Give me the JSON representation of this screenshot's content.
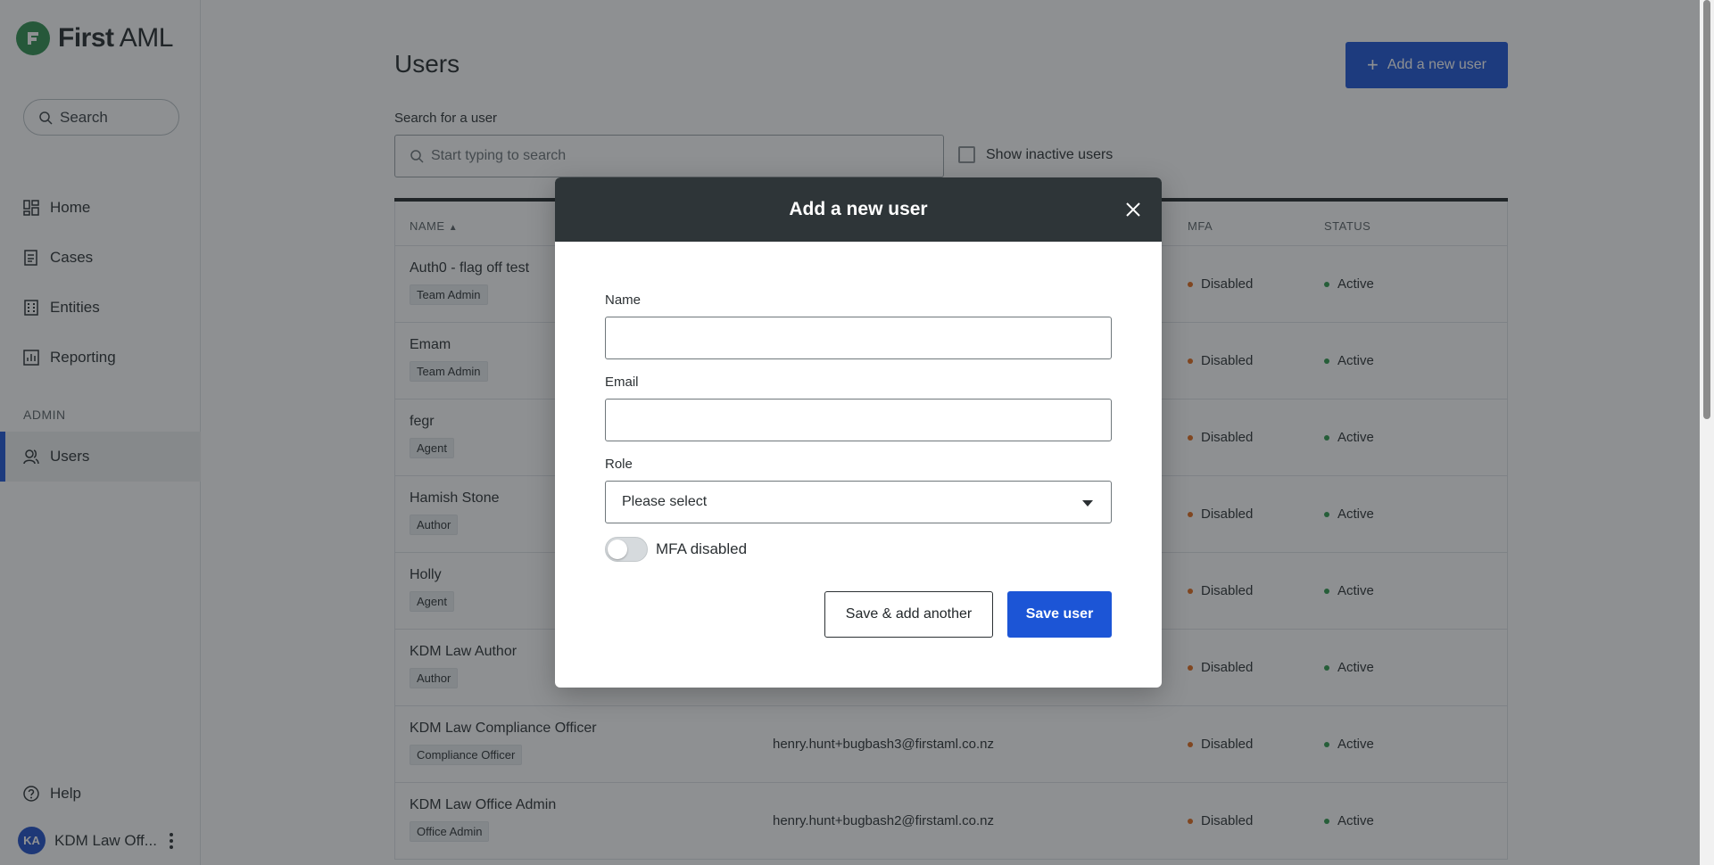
{
  "brand": {
    "name_bold": "First",
    "name_light": " AML",
    "accent": "#1c55d6",
    "logo_color": "#2f8f4e"
  },
  "sidebar": {
    "search_label": "Search",
    "items": [
      {
        "label": "Home",
        "icon": "grid-icon"
      },
      {
        "label": "Cases",
        "icon": "document-icon"
      },
      {
        "label": "Entities",
        "icon": "building-icon"
      },
      {
        "label": "Reporting",
        "icon": "chart-icon"
      }
    ],
    "admin_section": "ADMIN",
    "admin_items": [
      {
        "label": "Users",
        "icon": "users-icon",
        "active": true
      }
    ],
    "help_label": "Help",
    "user_initials": "KA",
    "user_name": "KDM Law Off..."
  },
  "main": {
    "title": "Users",
    "add_button": "Add a new user",
    "search_label": "Search for a user",
    "search_placeholder": "Start typing to search",
    "show_inactive_label": "Show inactive users",
    "columns": {
      "name": "NAME",
      "mfa": "MFA",
      "status": "STATUS"
    },
    "rows": [
      {
        "name": "Auth0 - flag off test",
        "role": "Team Admin",
        "email": "",
        "mfa": "Disabled",
        "status": "Active"
      },
      {
        "name": "Emam",
        "role": "Team Admin",
        "email": "",
        "mfa": "Disabled",
        "status": "Active"
      },
      {
        "name": "fegr",
        "role": "Agent",
        "email": "",
        "mfa": "Disabled",
        "status": "Active"
      },
      {
        "name": "Hamish Stone",
        "role": "Author",
        "email": "",
        "mfa": "Disabled",
        "status": "Active"
      },
      {
        "name": "Holly",
        "role": "Agent",
        "email": "",
        "mfa": "Disabled",
        "status": "Active"
      },
      {
        "name": "KDM Law Author",
        "role": "Author",
        "email": "",
        "mfa": "Disabled",
        "status": "Active"
      },
      {
        "name": "KDM Law Compliance Officer",
        "role": "Compliance Officer",
        "email": "henry.hunt+bugbash3@firstaml.co.nz",
        "mfa": "Disabled",
        "status": "Active"
      },
      {
        "name": "KDM Law Office Admin",
        "role": "Office Admin",
        "email": "henry.hunt+bugbash2@firstaml.co.nz",
        "mfa": "Disabled",
        "status": "Active"
      }
    ]
  },
  "modal": {
    "title": "Add a new user",
    "name_label": "Name",
    "name_value": "",
    "email_label": "Email",
    "email_value": "",
    "role_label": "Role",
    "role_value": "Please select",
    "mfa_toggle_label": "MFA disabled",
    "mfa_enabled": false,
    "save_another_label": "Save & add another",
    "save_label": "Save user"
  }
}
